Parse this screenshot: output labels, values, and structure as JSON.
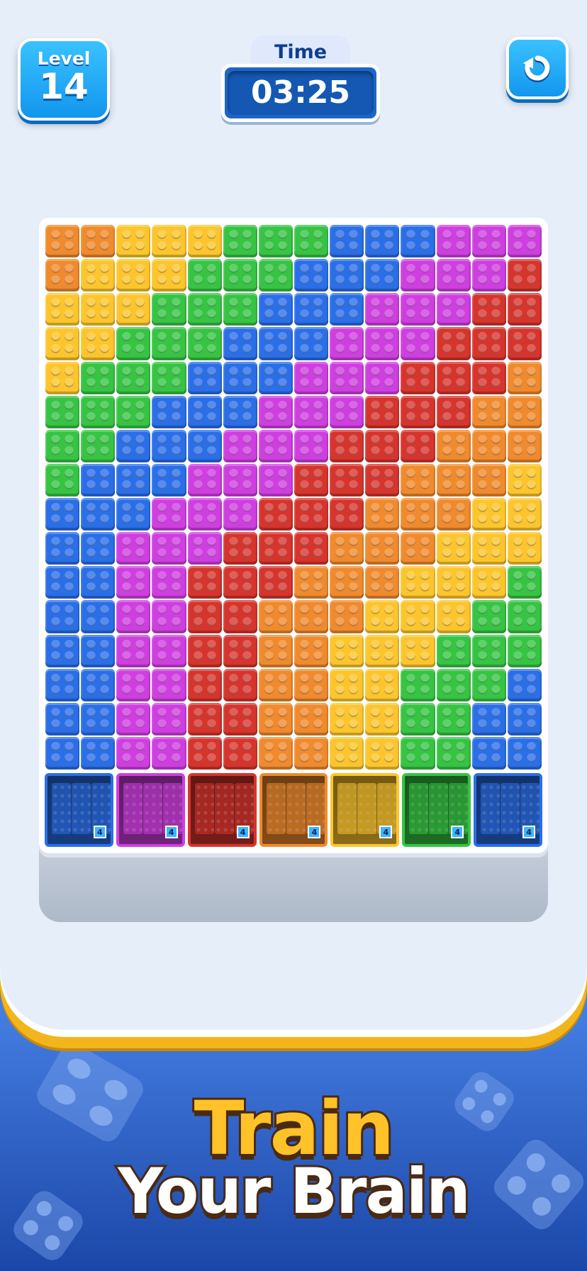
{
  "hud": {
    "level_label": "Level",
    "level_value": "14",
    "time_label": "Time",
    "time_value": "03:25",
    "restart_icon": "restart-icon"
  },
  "colors": {
    "O": "#f08a2c",
    "Y": "#fcc52c",
    "G": "#36c443",
    "B": "#2a6ee8",
    "M": "#cf3ee0",
    "R": "#d6342c"
  },
  "board": {
    "columns": 14,
    "rows": [
      "OOYYYGGGBBBMMM",
      "OYYYGGGBBBMMMR",
      "YYYGGGBBBMMMRR",
      "YYGGGBBBMMMRRR",
      "YGGGBBBMMMRRRO",
      "GGGBBBMMMRRROO",
      "GGBBBMMMRRROOO",
      "GBBBMMMRRROOOY",
      "BBBMMMRRROOOYY",
      "BBMMMRRROOOYYY",
      "BBMMRRROOOYYYG",
      "BBMMRROOOYYYGG",
      "BBMMRROOYYYGGG",
      "BBMMRROOYYGGGB",
      "BBMMRROOYYGGBB",
      "BBMMRROOYYGGBB"
    ]
  },
  "slots": [
    {
      "color": "B",
      "count": "4"
    },
    {
      "color": "M",
      "count": "4"
    },
    {
      "color": "R",
      "count": "4"
    },
    {
      "color": "O",
      "count": "4"
    },
    {
      "color": "Y",
      "count": "4"
    },
    {
      "color": "G",
      "count": "4"
    },
    {
      "color": "B",
      "count": "4"
    }
  ],
  "promo": {
    "line1": "Train",
    "line2": "Your Brain"
  }
}
